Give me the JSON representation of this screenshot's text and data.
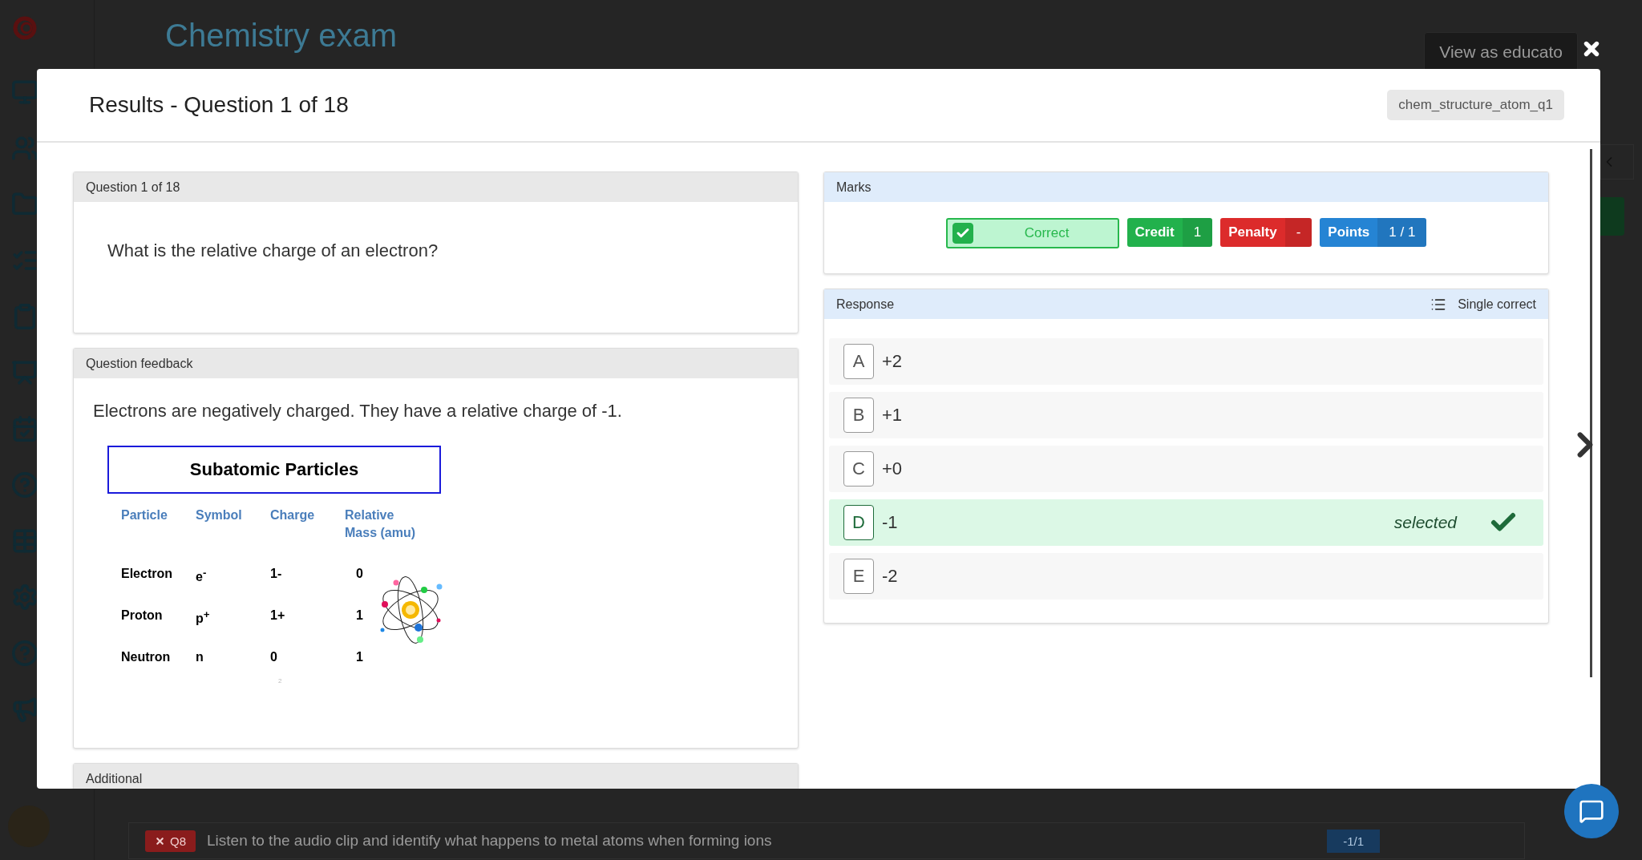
{
  "background_page": {
    "title": "Chemistry exam",
    "view_button": "View as educato",
    "bottom_row": {
      "badge": "Q8",
      "text": "Listen to the audio clip and identify what happens to metal atoms when forming ions",
      "score": "-1/1"
    }
  },
  "modal": {
    "title": "Results - Question 1 of 18",
    "tag": "chem_structure_atom_q1",
    "question": {
      "header": "Question 1 of 18",
      "text": "What is the relative charge of an electron?"
    },
    "feedback": {
      "header": "Question feedback",
      "text": "Electrons are negatively charged. They have a relative charge of -1.",
      "table": {
        "title": "Subatomic Particles",
        "columns": [
          "Particle",
          "Symbol",
          "Charge",
          "Relative Mass  (amu)"
        ],
        "rows": [
          [
            "Electron",
            "e$^{-}$",
            "1-",
            "0"
          ],
          [
            "Proton",
            "p$^{+}$",
            "1+",
            "1"
          ],
          [
            "Neutron",
            "n",
            "0",
            "1"
          ]
        ],
        "page_number": "2"
      }
    },
    "additional": {
      "header": "Additional"
    },
    "marks": {
      "header": "Marks",
      "result": {
        "label": "Correct",
        "checked": true
      },
      "badges": [
        {
          "label": "Credit",
          "value": "1",
          "color": "#22b14c"
        },
        {
          "label": "Penalty",
          "value": "-",
          "color": "#dc2b2b"
        },
        {
          "label": "Points",
          "value": "1 / 1",
          "color": "#2584d4"
        }
      ]
    },
    "response": {
      "header": "Response",
      "type": "Single correct",
      "selected_label": "selected",
      "options": [
        {
          "letter": "A",
          "text": "+2",
          "selected": false
        },
        {
          "letter": "B",
          "text": "+1",
          "selected": false
        },
        {
          "letter": "C",
          "text": "+0",
          "selected": false
        },
        {
          "letter": "D",
          "text": "-1",
          "selected": true
        },
        {
          "letter": "E",
          "text": "-2",
          "selected": false
        }
      ]
    }
  }
}
